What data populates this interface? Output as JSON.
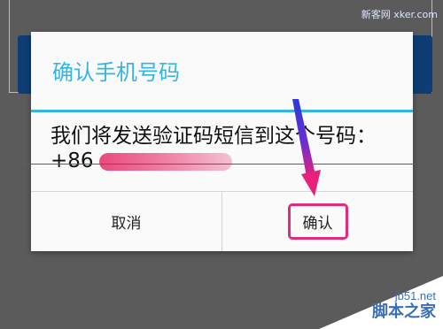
{
  "dialog": {
    "title": "确认手机号码",
    "message": "我们将发送验证码短信到这个号码：+86",
    "cancel_label": "取消",
    "confirm_label": "确认"
  },
  "watermarks": {
    "top": "新客网 xker.com",
    "site": "jb51.net",
    "name": "脚本之家"
  },
  "colors": {
    "title_accent": "#33b5e5",
    "highlight": "#e22c7a"
  }
}
